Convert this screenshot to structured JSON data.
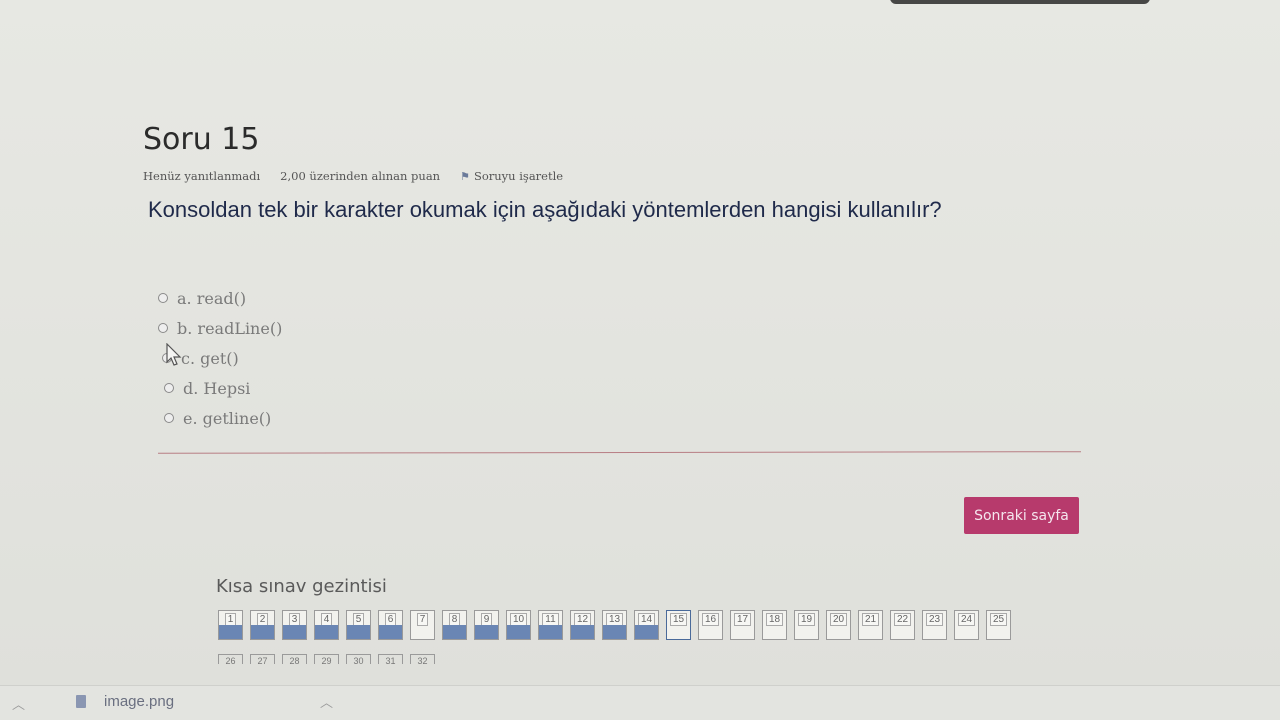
{
  "question": {
    "title": "Soru 15",
    "status": "Henüz yanıtlanmadı",
    "grade": "2,00 üzerinden alınan puan",
    "flag_label": "Soruyu işaretle",
    "text": "Konsoldan tek bir karakter okumak için aşağıdaki yöntemlerden hangisi kullanılır?",
    "options": [
      "a. read()",
      "b. readLine()",
      "c. get()",
      "d. Hepsi",
      "e. getline()"
    ]
  },
  "next_button": "Sonraki sayfa",
  "quiz_nav": {
    "title": "Kısa sınav gezintisi",
    "buttons": [
      {
        "label": "1",
        "state": "answered"
      },
      {
        "label": "2",
        "state": "answered"
      },
      {
        "label": "3",
        "state": "answered"
      },
      {
        "label": "4",
        "state": "answered"
      },
      {
        "label": "5",
        "state": "answered"
      },
      {
        "label": "6",
        "state": "answered"
      },
      {
        "label": "7",
        "state": "unanswered"
      },
      {
        "label": "8",
        "state": "answered"
      },
      {
        "label": "9",
        "state": "answered"
      },
      {
        "label": "10",
        "state": "answered"
      },
      {
        "label": "11",
        "state": "answered"
      },
      {
        "label": "12",
        "state": "answered"
      },
      {
        "label": "13",
        "state": "answered"
      },
      {
        "label": "14",
        "state": "answered"
      },
      {
        "label": "15",
        "state": "current"
      },
      {
        "label": "16",
        "state": "unanswered"
      },
      {
        "label": "17",
        "state": "unanswered"
      },
      {
        "label": "18",
        "state": "unanswered"
      },
      {
        "label": "19",
        "state": "unanswered"
      },
      {
        "label": "20",
        "state": "unanswered"
      },
      {
        "label": "21",
        "state": "unanswered"
      },
      {
        "label": "22",
        "state": "unanswered"
      },
      {
        "label": "23",
        "state": "unanswered"
      },
      {
        "label": "24",
        "state": "unanswered"
      },
      {
        "label": "25",
        "state": "unanswered"
      }
    ],
    "second_row": [
      "26",
      "27",
      "28",
      "29",
      "30",
      "31",
      "32"
    ]
  },
  "download_bar": {
    "file_name": "image.png"
  },
  "colors": {
    "next_button": "#b73a6c",
    "answered_fill": "#6a86b4",
    "divider": "#b87e84"
  }
}
